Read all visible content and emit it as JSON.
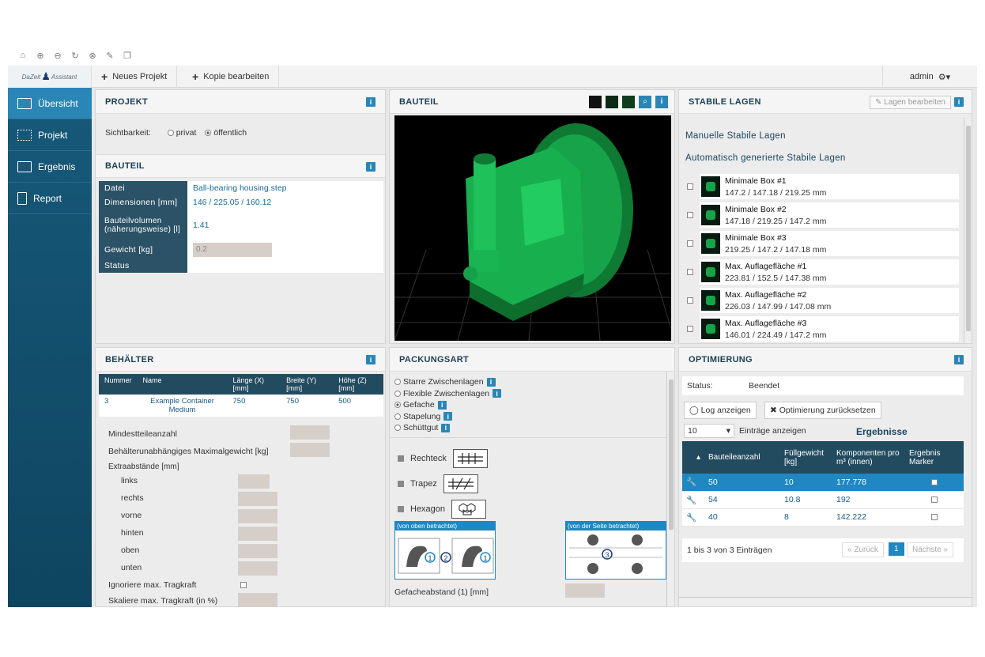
{
  "toolbar": {
    "new_project": "Neues Projekt",
    "edit_copy": "Kopie bearbeiten",
    "user": "admin",
    "logo_text": "Assistant"
  },
  "sidebar": {
    "items": [
      {
        "label": "Übersicht"
      },
      {
        "label": "Projekt"
      },
      {
        "label": "Ergebnis"
      },
      {
        "label": "Report"
      }
    ]
  },
  "projekt": {
    "title": "PROJEKT",
    "visibility_label": "Sichtbarkeit:",
    "opt_private": "privat",
    "opt_public": "öffentlich"
  },
  "bauteil_info": {
    "title": "BAUTEIL",
    "rows": [
      {
        "k": "Datei",
        "v": "Ball-bearing housing.step"
      },
      {
        "k": "Dimensionen [mm]",
        "v": "146 / 225.05 / 160.12"
      },
      {
        "k": "Bauteilvolumen (näherungsweise) [l]",
        "v": "1.41"
      },
      {
        "k": "Gewicht [kg]",
        "v": "0.2"
      },
      {
        "k": "Status",
        "v": ""
      }
    ]
  },
  "viewer": {
    "title": "BAUTEIL"
  },
  "stabile": {
    "title": "STABILE LAGEN",
    "edit_btn": "Lagen bearbeiten",
    "manual": "Manuelle Stabile Lagen",
    "auto": "Automatisch generierte Stabile Lagen",
    "items": [
      {
        "name": "Minimale Box #1",
        "dims": "147.2 / 147.18 / 219.25 mm"
      },
      {
        "name": "Minimale Box #2",
        "dims": "147.18 / 219.25 / 147.2 mm"
      },
      {
        "name": "Minimale Box #3",
        "dims": "219.25 / 147.2 / 147.18 mm"
      },
      {
        "name": "Max. Auflagefläche #1",
        "dims": "223.81 / 152.5 / 147.38 mm"
      },
      {
        "name": "Max. Auflagefläche #2",
        "dims": "226.03 / 147.99 / 147.08 mm"
      },
      {
        "name": "Max. Auflagefläche #3",
        "dims": "146.01 / 224.49 / 147.2 mm"
      }
    ]
  },
  "behaelter": {
    "title": "BEHÄLTER",
    "headers": [
      "Nummer",
      "Name",
      "Länge (X) [mm]",
      "Breite (Y) [mm]",
      "Höhe (Z) [mm]"
    ],
    "row": [
      "3",
      "Example Container Medium",
      "750",
      "750",
      "500"
    ],
    "min_parts": "Mindestteileanzahl",
    "max_weight": "Behälterunabhängiges Maximalgewicht [kg]",
    "extra": "Extraabstände [mm]",
    "sides": [
      "links",
      "rechts",
      "vorne",
      "hinten",
      "oben",
      "unten"
    ],
    "ignore": "Ignoriere max. Tragkraft",
    "scale": "Skaliere max. Tragkraft (in %)"
  },
  "packung": {
    "title": "PACKUNGSART",
    "options": [
      "Starre Zwischenlagen",
      "Flexible Zwischenlagen",
      "Gefache",
      "Stapelung",
      "Schüttgut"
    ],
    "patterns": [
      "Rechteck",
      "Trapez",
      "Hexagon"
    ],
    "view_top": "(von oben betrachtet)",
    "view_side": "(von der Seite betrachtet)",
    "n1": "1",
    "n2": "2",
    "n3": "3",
    "distance": "Gefacheabstand (1) [mm]"
  },
  "optim": {
    "title": "OPTIMIERUNG",
    "status_label": "Status:",
    "status_value": "Beendet",
    "log_btn": "Log anzeigen",
    "reset_btn": "Optimierung zurücksetzen",
    "page_size": "10",
    "entries_label": "Einträge anzeigen",
    "results_title": "Ergebnisse",
    "headers": [
      "Bauteileanzahl",
      "Füllgewicht [kg]",
      "Komponenten pro m³ (innen)",
      "Ergebnis Marker"
    ],
    "rows": [
      [
        "50",
        "10",
        "177.778"
      ],
      [
        "54",
        "10.8",
        "192"
      ],
      [
        "40",
        "8",
        "142.222"
      ]
    ],
    "footer": "1 bis 3 von 3 Einträgen",
    "prev": "« Zurück",
    "page": "1",
    "next": "Nächste »"
  },
  "colors": {
    "accent": "#2a86b5",
    "sidebar": "#17597a",
    "model": "#17a34a"
  }
}
